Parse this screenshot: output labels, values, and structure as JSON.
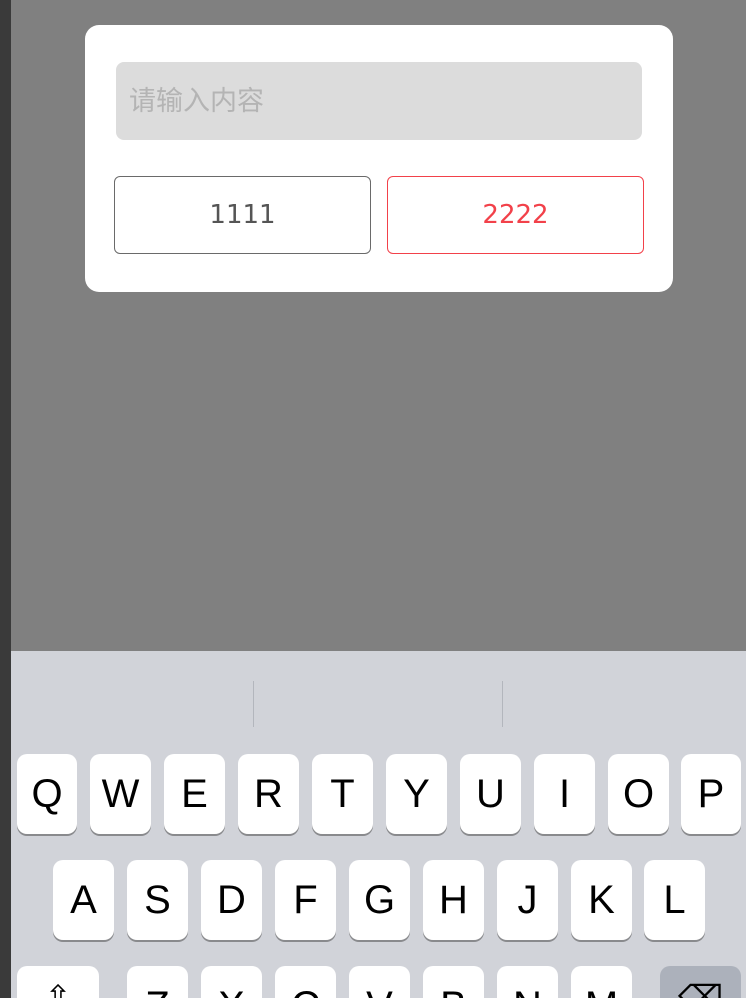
{
  "dialog": {
    "input_placeholder": "请输入内容",
    "button_left_label": "1111",
    "button_right_label": "2222",
    "accent_color": "#f2414a"
  },
  "keyboard": {
    "row1": [
      "Q",
      "W",
      "E",
      "R",
      "T",
      "Y",
      "U",
      "I",
      "O",
      "P"
    ],
    "row2": [
      "A",
      "S",
      "D",
      "F",
      "G",
      "H",
      "J",
      "K",
      "L"
    ],
    "row3": [
      "Z",
      "X",
      "C",
      "V",
      "B",
      "N",
      "M"
    ],
    "shift_icon": "shift-icon",
    "delete_icon": "backspace-icon"
  }
}
